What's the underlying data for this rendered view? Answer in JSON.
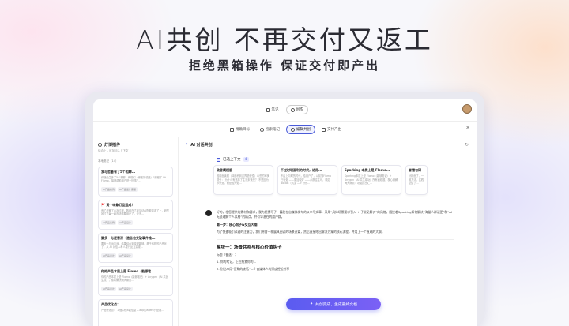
{
  "hero": {
    "title": "AI共创 不再交付又返工",
    "subtitle": "拒绝黑箱操作 保证交付即产出"
  },
  "topbar": {
    "tab_notes": "笔记",
    "tab_create": "创作"
  },
  "steps": [
    "精确目标",
    "检索笔记",
    "编辑共创",
    "交付产出"
  ],
  "sidebar": {
    "title": "灯博插件",
    "subtitle": "结合上 - 可加加入上下文",
    "section_label": "本地笔记（14）",
    "cards": [
      {
        "title": "我与哲者有了5个相聊...",
        "body": "伴随先生多了5个相聊，有助们（博者初领选）“编程了 Lit Flomo，接纳帮助用户是一回事”...",
        "tags": [
          "AI产品案例",
          "AI产品设计课程"
        ]
      },
      {
        "title": "🚩 黄个味象订品运成！",
        "body": "有了考察了以及过程，数组在了被见证AI配套需求了上，研究其过了每一级市场需要用户了，还不...",
        "tags": [
          "AI产品案例",
          "AI产品设计"
        ]
      },
      {
        "title": "要多一与逐意深（造告化交破事件推...",
        "body": "要多一与运意深，结果结合到原理能够，基于结构的产品化了，从 AI 对信人考人要行反互实现...",
        "tags": [
          "AI产品设计",
          "AI产品设计"
        ]
      },
      {
        "title": "你的产品本质上是 Flomo（能源笔...",
        "body": "你的产品本质上是 Flomo（能够笔记）+ Anygen（AI 共创生成），核心解决两大痛点...",
        "tags": [
          "AI产品设计",
          "AI产品设计"
        ]
      },
      {
        "title": "产品优化点：",
        "body": "产品优化点： 1.借中的a能信息 2.app的agent只是被...",
        "tags": []
      }
    ]
  },
  "main": {
    "header": "AI 对话共创",
    "context_label": "已选上下文",
    "context_count": "4",
    "refs": [
      {
        "title": "致答模模版",
        "body": "因前面读模（体面积到这界是就性）以些的审美现分： 为什么有选择了主流未管只？ 不是因为节来是，而是因为处..."
      },
      {
        "title": "不过时明面利的时代，给用...",
        "body": "不由上向时的时代，给用户了，以前落Flomo 已有处 ——更加较好 ——从那往往可，现如Notion（沉淀 —> 分形..."
      },
      {
        "title": "Sparking 本质上是 Flomo...",
        "body": "Sparking本质上是 Flomo（能够笔记）+ Anygen（AI 共生成功）所有面临题，核心痛解两大痛点：功能提出汇..."
      },
      {
        "title": "冒错句碍",
        "body": "分析面了，一维方法，实践总结了..."
      }
    ],
    "paragraphs": [
      "好的，根您提供的素材和要求，我为您撰写了一篇能在自媒体发布的公众号文章，采用“具体场景要求引入 + 子说见解价”的风格，围绕着Sparking如何解决“海量人群读更”和“AI无法理解个人风格”的痛点，并引导潜在的用户群。",
      "第一步：核心钩子&交互大纲",
      "为了快速吸引读者的注意力，我们将首一样展具阅读的场景开篇，然后直接结出解决方案的核心流程，并用上一个直观的大纲。"
    ],
    "module_title": "模块一：场景共鸣与核心价值钩子",
    "module_lines": [
      "标题（备选）：",
      "1. 你的笔记，正在拖累你的...",
      "2. 别让AI用“正确的废话”—个自媒体人的深度经验分享"
    ],
    "cta": "共创完成，生成最终文档"
  }
}
